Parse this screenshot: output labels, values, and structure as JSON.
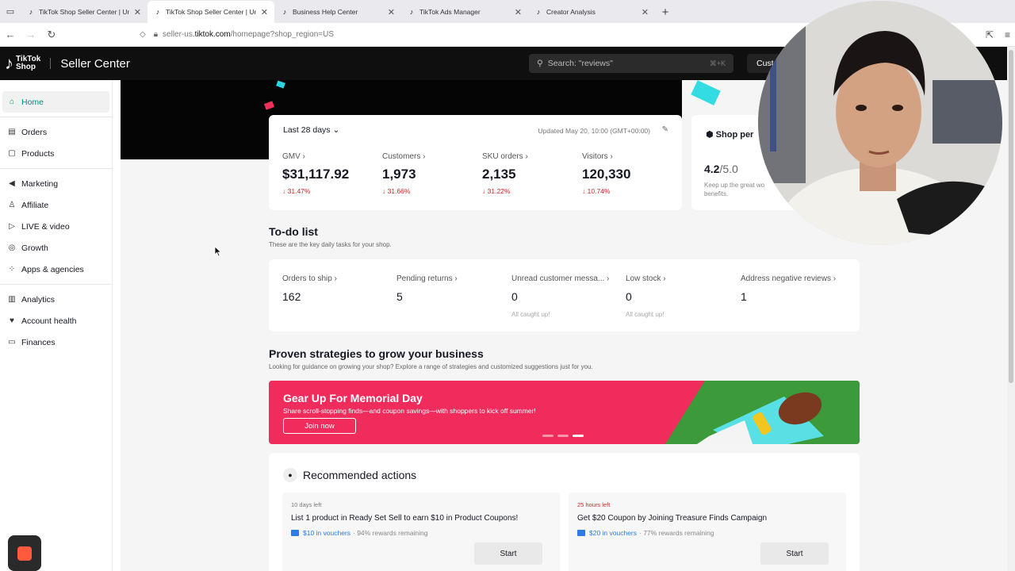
{
  "browser": {
    "tabs": [
      {
        "title": "TikTok Shop Seller Center | Unit",
        "active": false
      },
      {
        "title": "TikTok Shop Seller Center | Unit",
        "active": true
      },
      {
        "title": "Business Help Center",
        "active": false
      },
      {
        "title": "TikTok Ads Manager",
        "active": false
      },
      {
        "title": "Creator Analysis",
        "active": false
      }
    ],
    "url_host": "seller-us.tiktok.com",
    "url_path": "/homepage?shop_region=US",
    "url_prefix": "seller-us.",
    "url_domain": "tiktok.com"
  },
  "header": {
    "brand_line1": "TikTok",
    "brand_line2": "Shop",
    "title": "Seller Center",
    "search_placeholder": "Search: \"reviews\"",
    "search_shortcut": "⌘+K",
    "customize_label": "Cust"
  },
  "sidebar": {
    "items": [
      {
        "label": "Home",
        "icon": "home-icon",
        "active": true
      },
      {
        "label": "Orders",
        "icon": "orders-icon"
      },
      {
        "label": "Products",
        "icon": "products-icon"
      },
      {
        "label": "Marketing",
        "icon": "megaphone-icon"
      },
      {
        "label": "Affiliate",
        "icon": "people-icon"
      },
      {
        "label": "LIVE & video",
        "icon": "video-icon"
      },
      {
        "label": "Growth",
        "icon": "growth-icon"
      },
      {
        "label": "Apps & agencies",
        "icon": "apps-icon"
      },
      {
        "label": "Analytics",
        "icon": "analytics-icon"
      },
      {
        "label": "Account health",
        "icon": "trophy-icon"
      },
      {
        "label": "Finances",
        "icon": "wallet-icon"
      }
    ]
  },
  "stats": {
    "range": "Last 28 days",
    "updated": "Updated May 20, 10:00 (GMT+00:00)",
    "metrics": [
      {
        "label": "GMV",
        "value": "$31,117.92",
        "change": "31.47%"
      },
      {
        "label": "Customers",
        "value": "1,973",
        "change": "31.66%"
      },
      {
        "label": "SKU orders",
        "value": "2,135",
        "change": "31.22%"
      },
      {
        "label": "Visitors",
        "value": "120,330",
        "change": "10.74%"
      }
    ]
  },
  "shop_perf": {
    "title": "Shop per",
    "score": "4.2",
    "score_max": "/5.0",
    "tip_line1": "Keep up the great wo",
    "tip_line2": "benefits."
  },
  "todo": {
    "title": "To-do list",
    "subtitle": "These are the key daily tasks for your shop.",
    "items": [
      {
        "label": "Orders to ship",
        "value": "162",
        "note": ""
      },
      {
        "label": "Pending returns",
        "value": "5",
        "note": ""
      },
      {
        "label": "Unread customer messa...",
        "value": "0",
        "note": "All caught up!"
      },
      {
        "label": "Low stock",
        "value": "0",
        "note": "All caught up!"
      },
      {
        "label": "Address negative reviews",
        "value": "1",
        "note": ""
      }
    ]
  },
  "strategies": {
    "title": "Proven strategies to grow your business",
    "subtitle": "Looking for guidance on growing your shop? Explore a range of strategies and customized suggestions just for you.",
    "banner_title": "Gear Up For Memorial Day",
    "banner_subtitle": "Share scroll-stopping finds—and coupon savings—with shoppers to kick off summer!",
    "banner_cta": "Join now"
  },
  "recommended": {
    "title": "Recommended actions",
    "cards": [
      {
        "time_left": "10 days left",
        "name": "List 1 product in Ready Set Sell to earn $10 in Product Coupons!",
        "voucher": "$10 in vouchers",
        "rewards": "· 94% rewards remaining",
        "cta": "Start"
      },
      {
        "time_left": "25 hours left",
        "name": "Get $20 Coupon by Joining Treasure Finds Campaign",
        "voucher": "$20 in vouchers",
        "rewards": "· 77% rewards remaining",
        "cta": "Start"
      }
    ]
  },
  "colors": {
    "accent": "#008d80",
    "banner": "#ef2c5b",
    "negative": "#c42a2a",
    "link": "#2f7ae5"
  }
}
